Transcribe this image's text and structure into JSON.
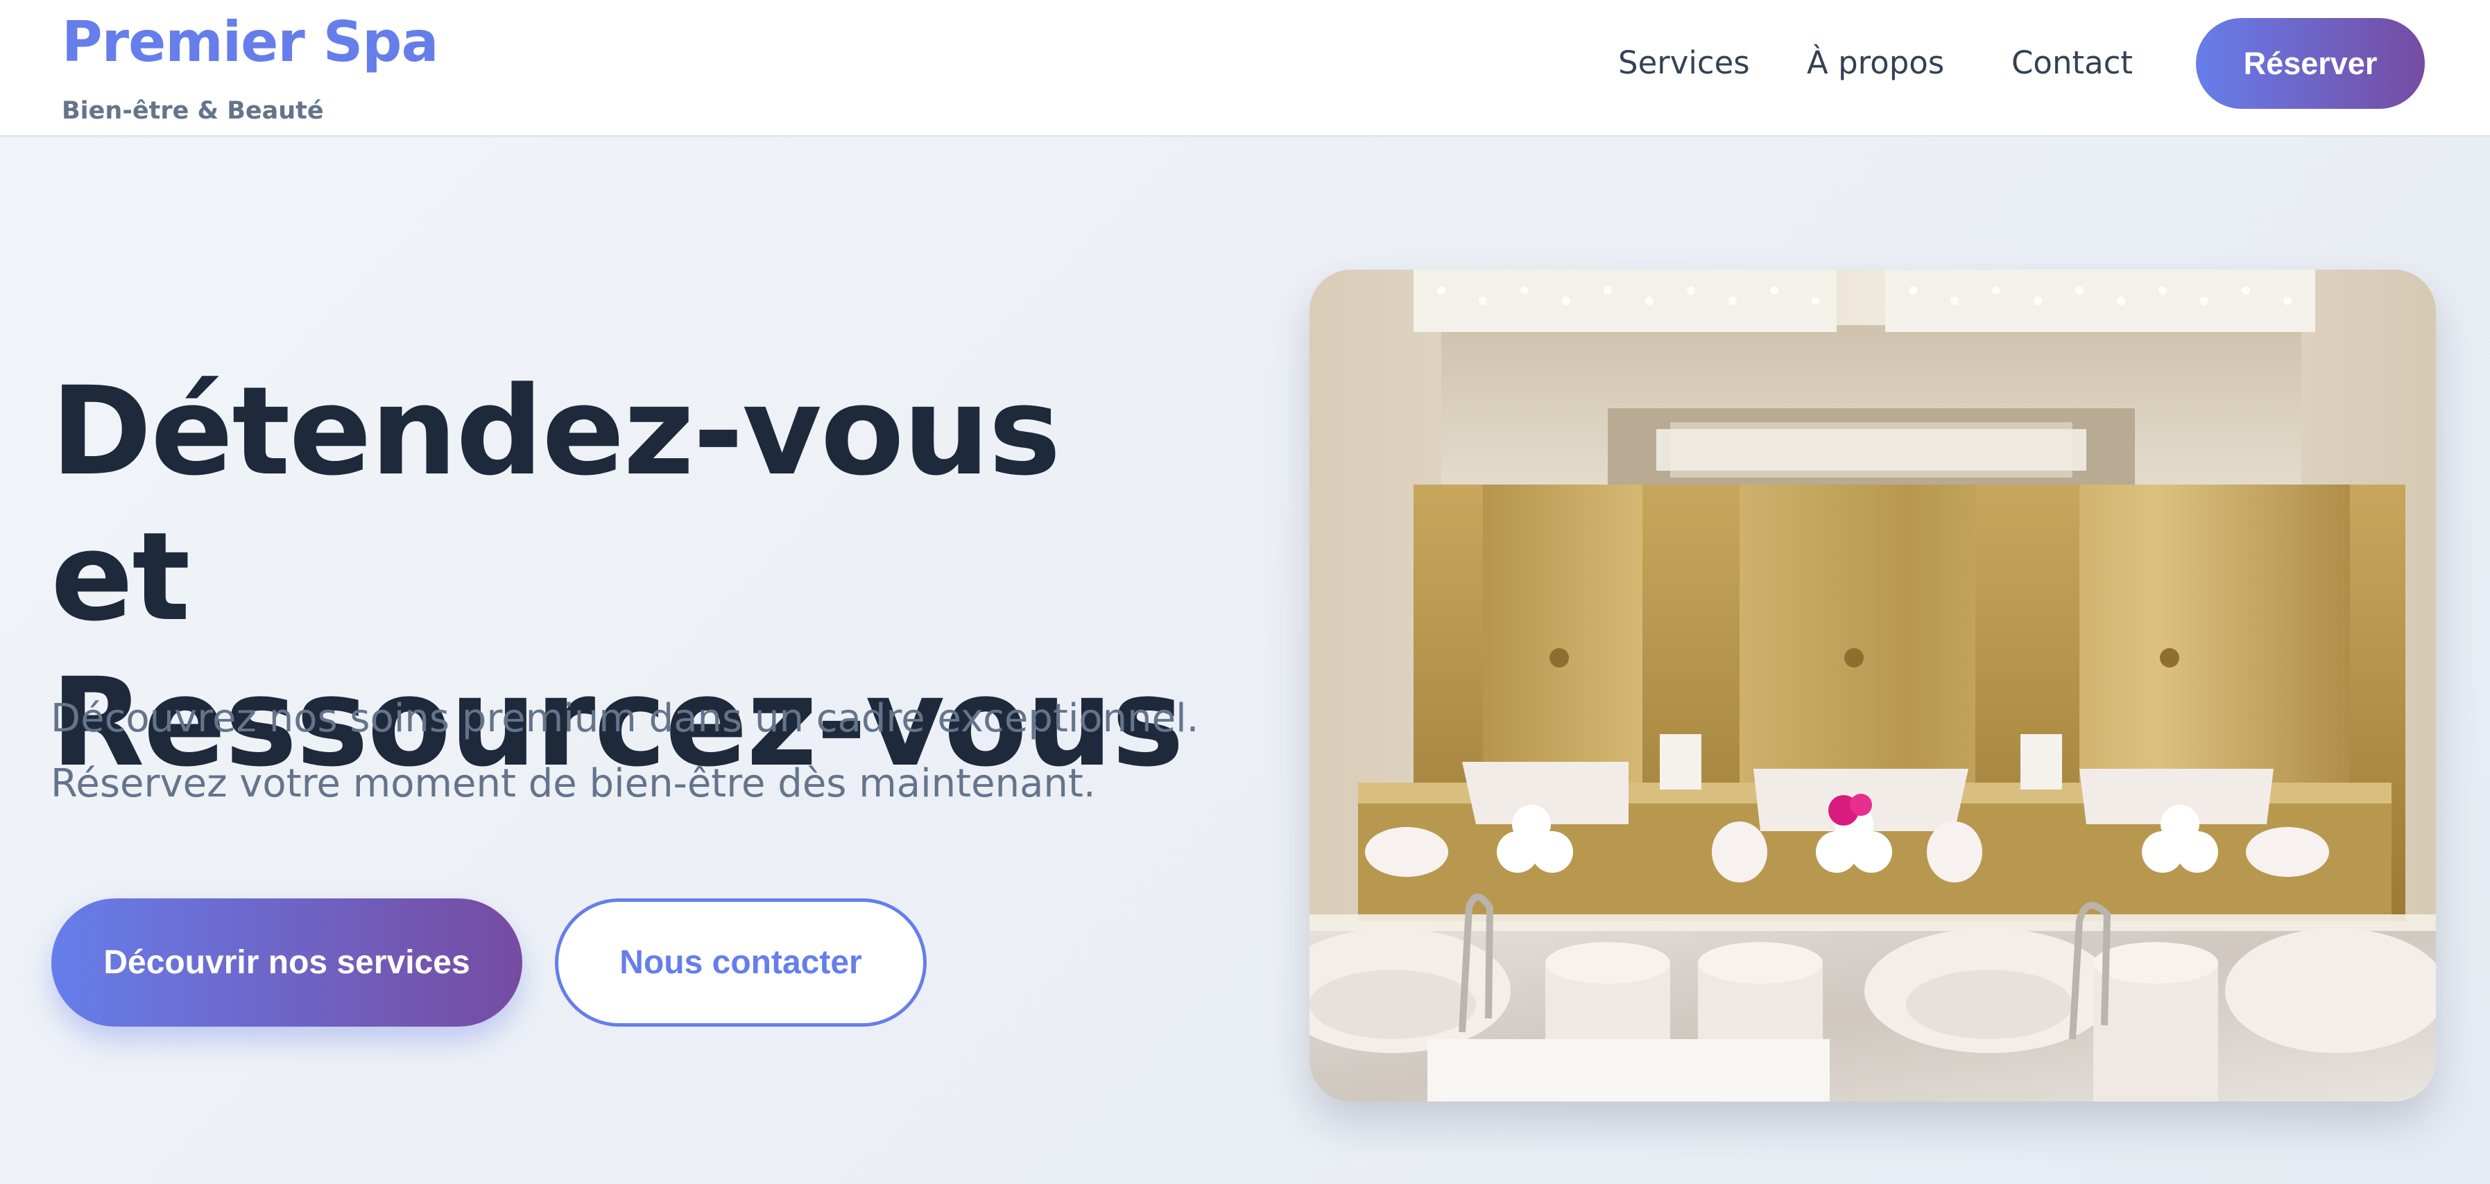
{
  "header": {
    "brand_title": "Premier Spa",
    "brand_subtitle": "Bien-être & Beauté",
    "nav": {
      "services": "Services",
      "about": "À propos",
      "contact": "Contact"
    },
    "reserve_label": "Réserver"
  },
  "hero": {
    "title_line1": "Détendez-vous et",
    "title_line2": "Ressourcez-vous",
    "description_line1": "Découvrez nos soins premium dans un cadre exceptionnel.",
    "description_line2": "Réservez votre moment de bien-être dès maintenant.",
    "primary_cta": "Découvrir nos services",
    "secondary_cta": "Nous contacter"
  },
  "colors": {
    "accent": "#667eea",
    "accent_end": "#764ba2",
    "heading": "#1e293b",
    "muted": "#64748b"
  }
}
